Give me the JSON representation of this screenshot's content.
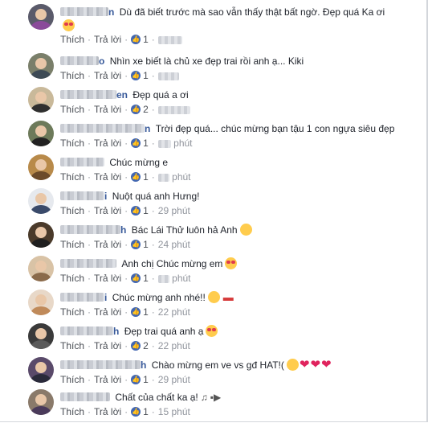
{
  "actions": {
    "like_label": "Thích",
    "reply_label": "Trả lời",
    "separator": "·"
  },
  "comments": [
    {
      "name_tail": "n",
      "text": "Dù đã biết trước mà sao vẫn thấy thật bất ngờ. Đẹp quá Ka ơi",
      "emoji_line2": "smiling-face-with-heart-eyes",
      "likes": "1",
      "time": ""
    },
    {
      "name_tail": "o",
      "text": "Nhìn xe biết là chủ xe đẹp trai rồi anh ạ... Kiki",
      "likes": "1",
      "time": "phút"
    },
    {
      "name_tail": "en",
      "text": "Đẹp quá a ơi",
      "likes": "2",
      "time": "phút"
    },
    {
      "name_tail": "n",
      "text": "Trời đẹp quá... chúc mừng bạn tậu 1 con ngựa siêu đẹp",
      "likes": "1",
      "time": "phút"
    },
    {
      "name_tail": "",
      "text": "Chúc mừng e",
      "likes": "1",
      "time": "phút"
    },
    {
      "name_tail": "i",
      "text": "Nuột quá anh Hưng!",
      "likes": "1",
      "time": "29 phút"
    },
    {
      "name_tail": "h",
      "text": "Bác Lái Thử luôn hả Anh",
      "emoji": "kissing-face",
      "likes": "1",
      "time": "24 phút"
    },
    {
      "name_tail": "",
      "text": "Anh chị Chúc mừng em",
      "emoji": "smiling-face-with-heart-eyes",
      "likes": "1",
      "time": "phút"
    },
    {
      "name_tail": "i",
      "text": "Chúc mừng anh nhé!!",
      "emoji": "hugging-face",
      "extra": "car",
      "likes": "1",
      "time": "22 phút"
    },
    {
      "name_tail": "h",
      "text": "Đẹp trai quá anh ạ",
      "emoji": "smiling-face-with-heart-eyes",
      "likes": "2",
      "time": "22 phút"
    },
    {
      "name_tail": "h",
      "text": "Chào mừng em ve vs gđ HAT!(",
      "emoji": "smiling-face",
      "extra": "hearts",
      "likes": "1",
      "time": "29 phút"
    },
    {
      "name_tail": "",
      "text": "Chất của chất ka ạ!",
      "extra": "mic-speaker",
      "likes": "1",
      "time": "15 phút"
    }
  ],
  "colors": {
    "like_blue": "#4267b2",
    "name_blue": "#365899",
    "meta_gray": "#90949c"
  }
}
